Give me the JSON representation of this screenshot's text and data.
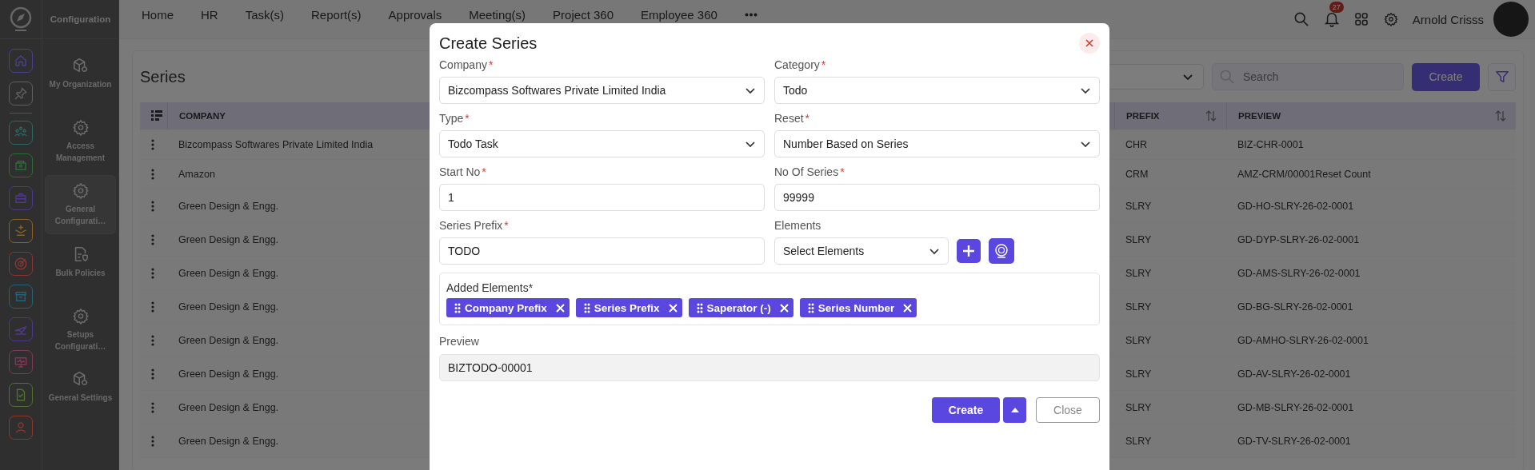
{
  "rail": {
    "items": [
      {
        "color": "#4a4290"
      },
      {
        "color": "#606060"
      },
      {
        "color": "#2a6a65"
      },
      {
        "color": "#306b36"
      },
      {
        "color": "#52378f"
      },
      {
        "color": "#8a6323"
      },
      {
        "color": "#8a3636"
      },
      {
        "color": "#256377"
      },
      {
        "color": "#52378f"
      },
      {
        "color": "#853659"
      },
      {
        "color": "#50722c"
      },
      {
        "color": "#8a392e"
      }
    ]
  },
  "module_nav": {
    "title": "Configuration",
    "items": [
      {
        "label": "My Organization",
        "selected": false
      },
      {
        "label": "Access Management",
        "selected": false
      },
      {
        "label": "General Configurati…",
        "selected": true
      },
      {
        "label": "Bulk Policies",
        "selected": false
      },
      {
        "label": "Setups Configurati…",
        "selected": false
      },
      {
        "label": "General Settings",
        "selected": false
      }
    ]
  },
  "top_nav": {
    "items": [
      "Home",
      "HR",
      "Task(s)",
      "Report(s)",
      "Approvals",
      "Meeting(s)",
      "Project 360",
      "Employee 360"
    ]
  },
  "header": {
    "notification_count": "27",
    "user_name": "Arnold Crisss"
  },
  "page": {
    "title": "Series",
    "search": {
      "placeholder": "Search"
    },
    "create_button": "Create"
  },
  "table": {
    "columns": [
      {
        "label": "COMPANY"
      },
      {
        "label": "PREFIX",
        "sortable": true
      },
      {
        "label": "PREVIEW",
        "sortable": true
      }
    ],
    "rows": [
      {
        "company": "Bizcompass Softwares Private Limited India",
        "prefix": "CHR",
        "preview": "BIZ-CHR-0001"
      },
      {
        "company": "Amazon",
        "prefix": "CRM",
        "preview": "AMZ-CRM/00001Reset Count"
      },
      {
        "company": "Green Design & Engg.",
        "prefix": "SLRY",
        "preview": "GD-HO-SLRY-26-02-0001"
      },
      {
        "company": "Green Design & Engg.",
        "prefix": "SLRY",
        "preview": "GD-DYP-SLRY-26-02-0001"
      },
      {
        "company": "Green Design & Engg.",
        "prefix": "SLRY",
        "preview": "GD-AMS-SLRY-26-02-0001"
      },
      {
        "company": "Green Design & Engg.",
        "prefix": "SLRY",
        "preview": "GD-BG-SLRY-26-02-0001"
      },
      {
        "company": "Green Design & Engg.",
        "prefix": "SLRY",
        "preview": "GD-AMHO-SLRY-26-02-0001"
      },
      {
        "company": "Green Design & Engg.",
        "prefix": "SLRY",
        "preview": "GD-AV-SLRY-26-02-0001"
      },
      {
        "company": "Green Design & Engg.",
        "prefix": "SLRY",
        "preview": "GD-MB-SLRY-26-02-0001"
      },
      {
        "company": "Green Design & Engg.",
        "prefix": "SLRY",
        "preview": "GD-TV-SLRY-26-02-0001"
      }
    ]
  },
  "modal": {
    "title": "Create Series",
    "fields": [
      {
        "label": "Company",
        "required_mark": "*",
        "kind": "select",
        "value": "Bizcompass Softwares Private Limited India"
      },
      {
        "label": "Category",
        "required_mark": "*",
        "kind": "select",
        "value": "Todo"
      },
      {
        "label": "Type",
        "required_mark": "*",
        "kind": "select",
        "value": "Todo Task"
      },
      {
        "label": "Reset",
        "required_mark": "*",
        "kind": "select",
        "value": "Number Based on Series"
      },
      {
        "label": "Start No",
        "required_mark": "*",
        "kind": "input",
        "value": "1"
      },
      {
        "label": "No Of Series",
        "required_mark": "*",
        "kind": "input",
        "value": "99999"
      },
      {
        "label": "Series Prefix",
        "required_mark": "*",
        "kind": "input",
        "value": "TODO"
      }
    ],
    "elements": {
      "label": "Elements",
      "placeholder": "Select Elements"
    },
    "added_elements": {
      "label": "Added Elements*",
      "chips": [
        "Company Prefix",
        "Series Prefix",
        "Saperator (-)",
        "Series Number"
      ]
    },
    "preview": {
      "label": "Preview",
      "value": "BIZTODO-00001"
    },
    "buttons": {
      "create": "Create",
      "close": "Close"
    }
  }
}
